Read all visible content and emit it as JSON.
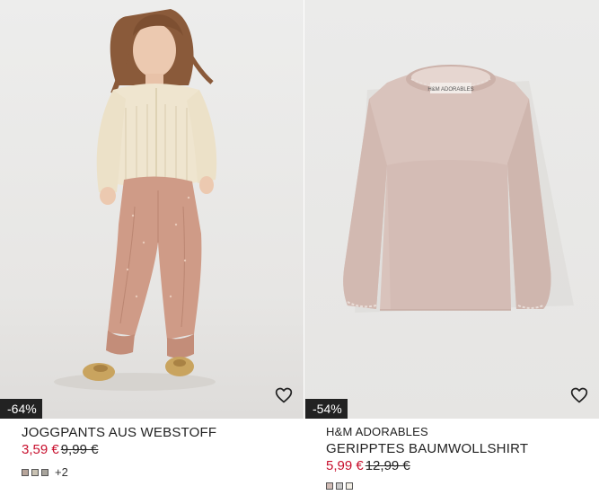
{
  "products": [
    {
      "discount": "-64%",
      "name": "JOGGPANTS AUS WEBSTOFF",
      "price_sale": "3,59 €",
      "price_original": "9,99 €",
      "swatch_colors": [
        "#b7a59a",
        "#c9c2b3",
        "#a8a49c"
      ],
      "more_colors": "+2",
      "favorite_icon": "heart-outline-icon"
    },
    {
      "discount": "-54%",
      "brand": "H&M ADORABLES",
      "name": "GERIPPTES BAUMWOLLSHIRT",
      "price_sale": "5,99 €",
      "price_original": "12,99 €",
      "swatch_colors": [
        "#d1bcb6",
        "#c9c9c9",
        "#f3efe6"
      ],
      "favorite_icon": "heart-outline-icon"
    }
  ]
}
